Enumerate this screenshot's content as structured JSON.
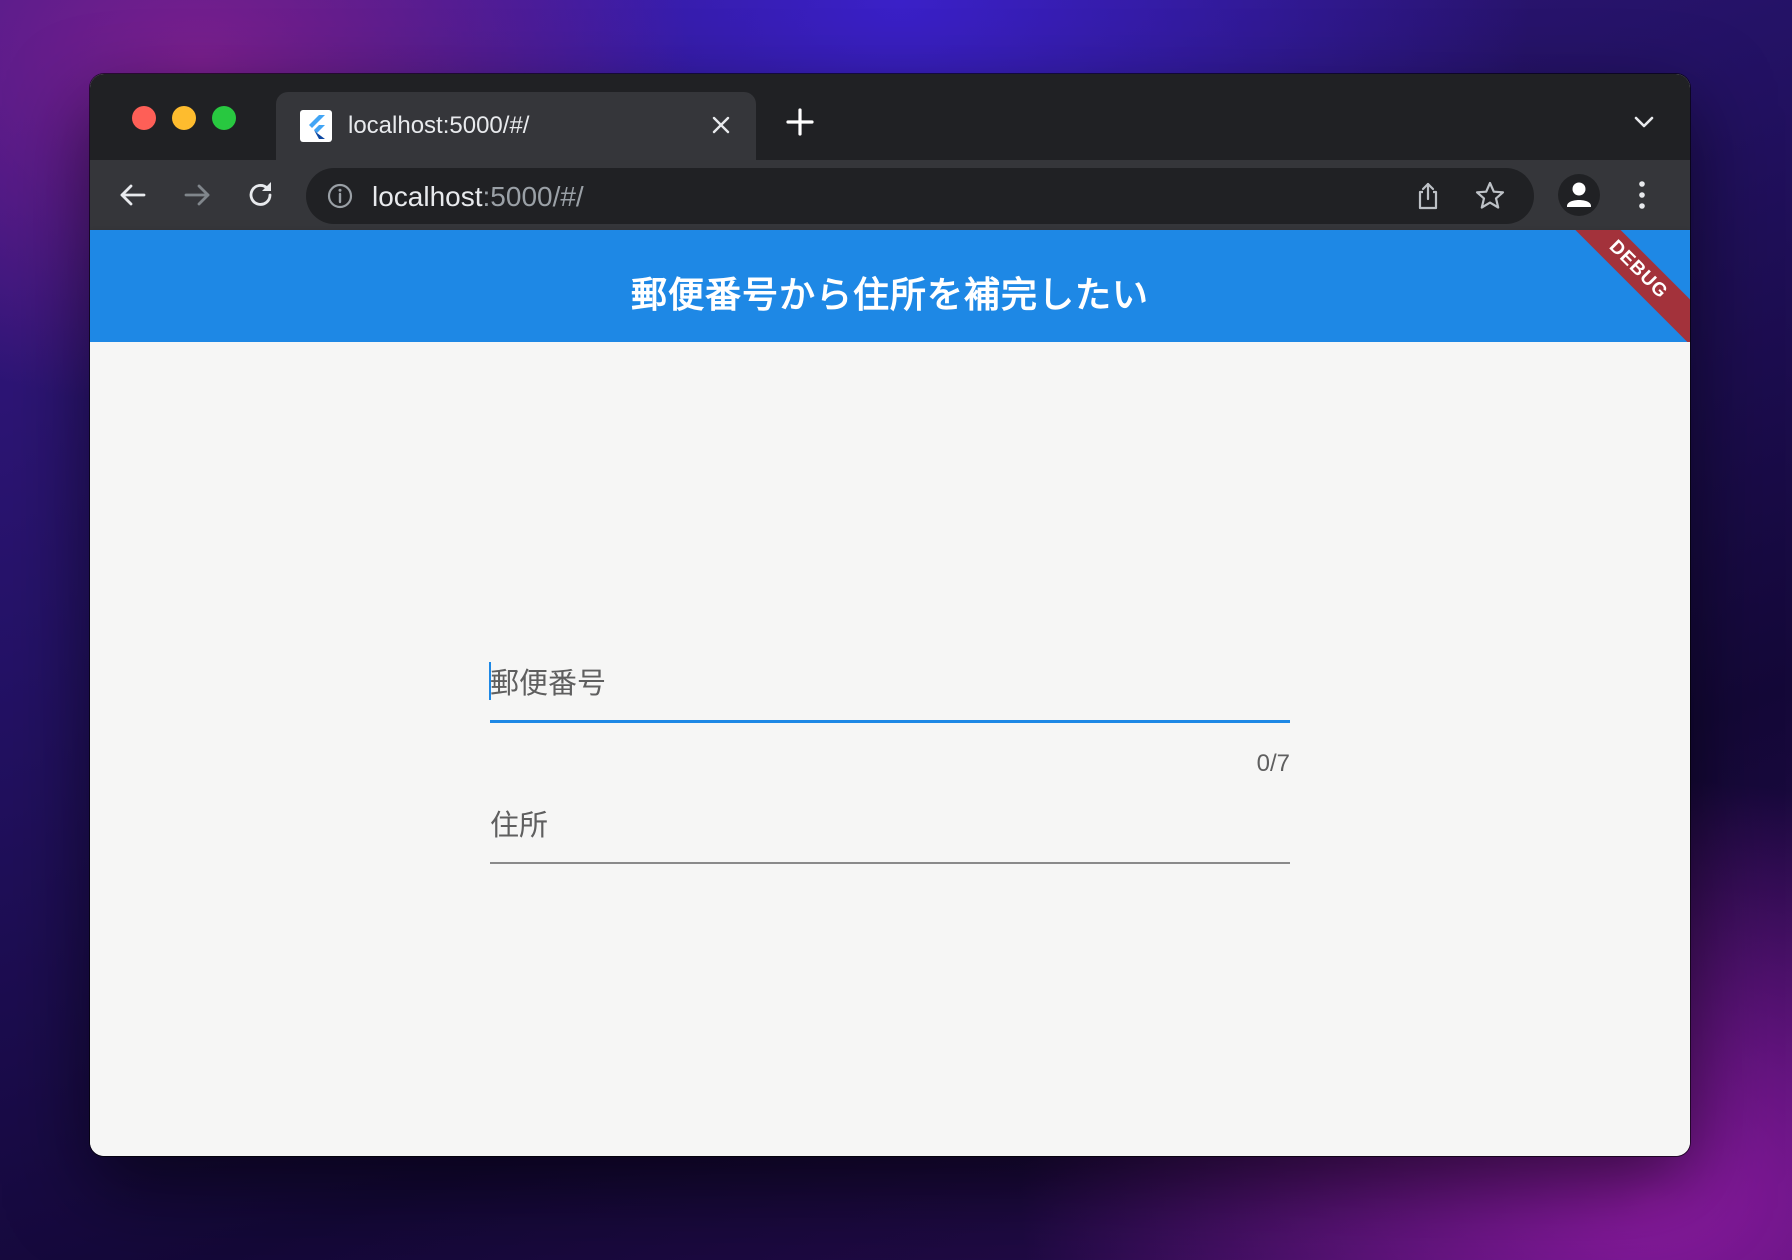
{
  "browser": {
    "tab": {
      "title": "localhost:5000/#/",
      "favicon": "flutter-icon"
    },
    "address_bar": {
      "host": "localhost",
      "rest": ":5000/#/"
    },
    "icons": {
      "back": "arrow-left-icon",
      "forward": "arrow-right-icon",
      "reload": "reload-icon",
      "info": "info-icon",
      "share": "share-icon",
      "bookmark": "star-icon",
      "profile": "person-icon",
      "menu": "kebab-menu-icon",
      "new_tab": "plus-icon",
      "tab_close": "close-icon",
      "tab_search": "chevron-down-icon"
    }
  },
  "app": {
    "title": "郵便番号から住所を補完したい",
    "debug_banner": "DEBUG",
    "colors": {
      "primary": "#1e88e5",
      "banner": "#a3323b"
    },
    "form": {
      "postal_code": {
        "label": "郵便番号",
        "value": "",
        "counter": "0/7",
        "focused": true
      },
      "address": {
        "label": "住所",
        "value": ""
      }
    }
  }
}
